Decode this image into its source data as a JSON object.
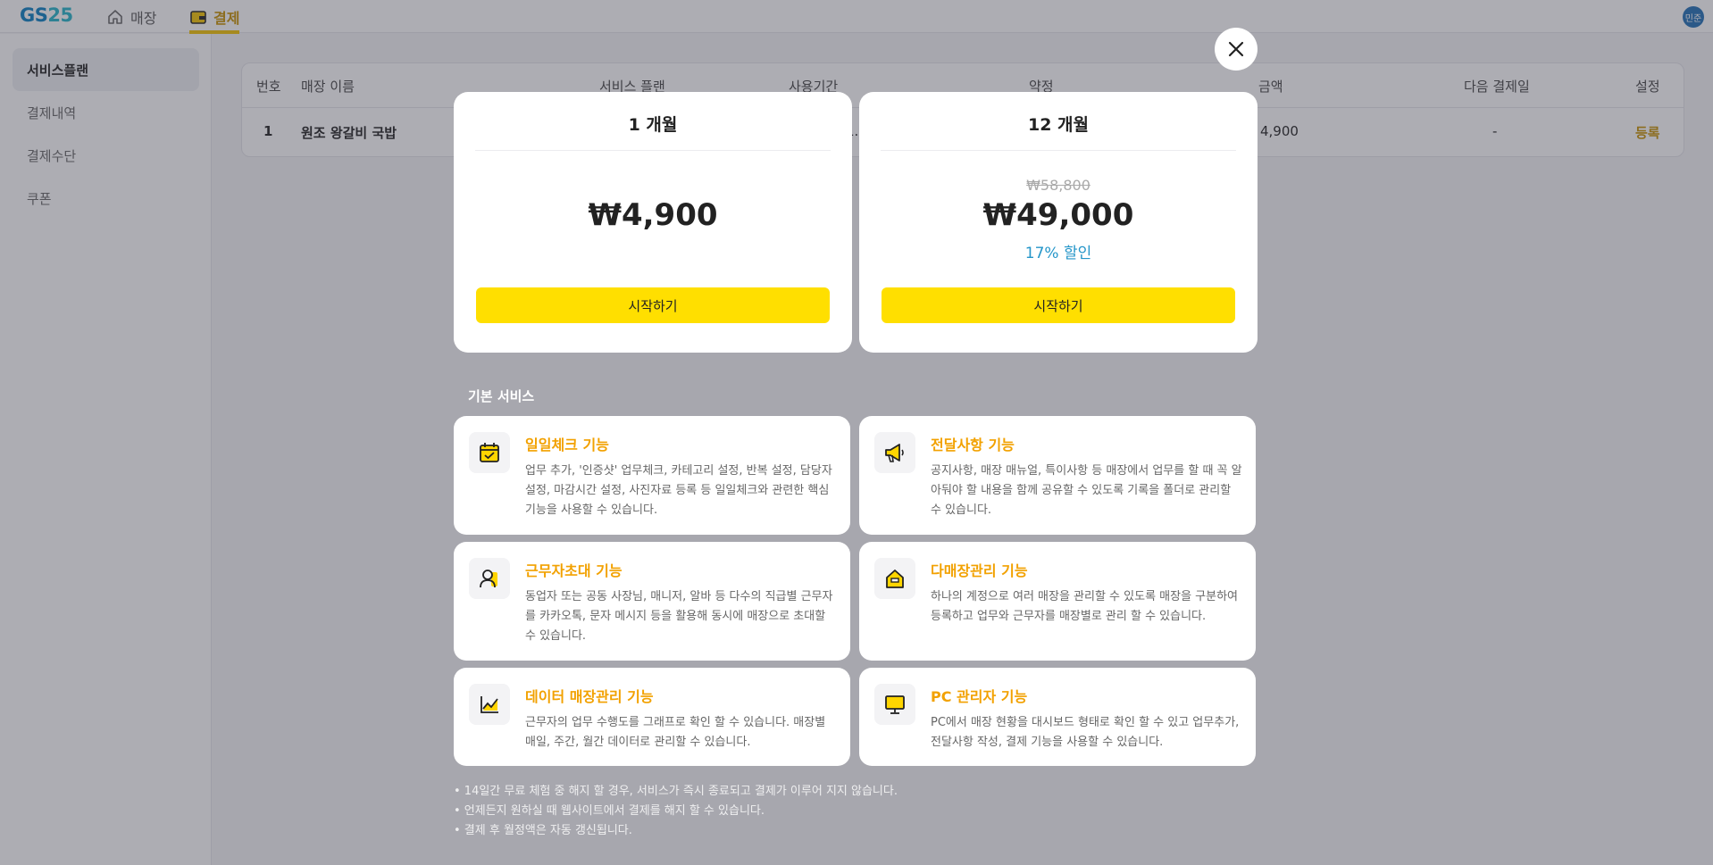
{
  "app": {
    "logo_gs": "GS",
    "logo_25": "25",
    "nav": [
      {
        "label": "매장",
        "icon": "home-icon"
      },
      {
        "label": "결제",
        "icon": "wallet-icon"
      }
    ],
    "avatar": "민준"
  },
  "sidebar": {
    "items": [
      {
        "label": "서비스플랜"
      },
      {
        "label": "결제내역"
      },
      {
        "label": "결제수단"
      },
      {
        "label": "쿠폰"
      }
    ]
  },
  "table": {
    "headers": [
      "번호",
      "매장 이름",
      "서비스 플랜",
      "사용기간",
      "약정",
      "금액",
      "다음 결제일",
      "설정"
    ],
    "rows": [
      {
        "no": "1",
        "name": "원조 왕갈비 국밥",
        "period_fragment": "1.",
        "amount_fragment": "4,900",
        "next": "-",
        "action": "등록"
      }
    ]
  },
  "modal": {
    "plans": [
      {
        "title": "1 개월",
        "price": "₩4,900",
        "original": "",
        "discount": "",
        "button": "시작하기"
      },
      {
        "title": "12 개월",
        "price": "₩49,000",
        "original": "₩58,800",
        "discount": "17% 할인",
        "button": "시작하기"
      }
    ],
    "section_title": "기본 서비스",
    "features": [
      {
        "icon": "calendar-check-icon",
        "title": "일일체크 기능",
        "desc": "업무 추가, '인증샷' 업무체크, 카테고리 설정, 반복 설정, 담당자 설정, 마감시간 설정, 사진자료 등록 등 일일체크와 관련한 핵심 기능을 사용할 수 있습니다."
      },
      {
        "icon": "megaphone-icon",
        "title": "전달사항 기능",
        "desc": "공지사항, 매장 매뉴얼, 특이사항 등 매장에서 업무를 할 때 꼭 알아둬야 할 내용을 함께 공유할 수 있도록 기록을 폴더로 관리할 수 있습니다."
      },
      {
        "icon": "person-invite-icon",
        "title": "근무자초대 기능",
        "desc": "동업자 또는 공동 사장님, 매니저, 알바 등 다수의 직급별 근무자를 카카오톡, 문자 메시지 등을 활용해 동시에 매장으로 초대할 수 있습니다."
      },
      {
        "icon": "store-icon",
        "title": "다매장관리 기능",
        "desc": "하나의 계정으로 여러 매장을 관리할 수 있도록 매장을 구분하여 등록하고 업무와 근무자를 매장별로 관리 할 수 있습니다."
      },
      {
        "icon": "chart-icon",
        "title": "데이터 매장관리 기능",
        "desc": "근무자의 업무 수행도를 그래프로 확인 할 수 있습니다. 매장별 매일, 주간, 월간 데이터로 관리할 수 있습니다."
      },
      {
        "icon": "monitor-icon",
        "title": "PC 관리자 기능",
        "desc": "PC에서 매장 현황을 대시보드 형태로 확인 할 수 있고 업무추가, 전달사항 작성, 결제 기능을 사용할 수 있습니다."
      }
    ],
    "notes": [
      "• 14일간 무료 체험 중 해지 할 경우, 서비스가 즉시 종료되고 결제가 이루어 지지 않습니다.",
      "• 언제든지 원하실 때 웹사이트에서 결제를 해지 할 수 있습니다.",
      "• 결제 후 월정액은 자동 갱신됩니다."
    ]
  }
}
